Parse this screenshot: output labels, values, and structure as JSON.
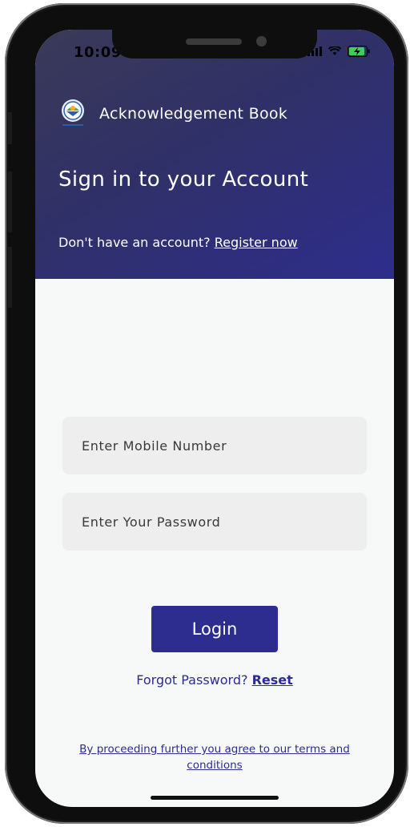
{
  "status_bar": {
    "time": "10:09",
    "icons": [
      "signal-icon",
      "wifi-icon",
      "battery-charging-icon"
    ]
  },
  "header": {
    "app_title": "Acknowledgement Book",
    "logo_icon": "app-logo-icon",
    "heading": "Sign in to your Account",
    "register_prompt": "Don't have an account?",
    "register_link": "Register now"
  },
  "form": {
    "mobile_placeholder": "Enter Mobile Number",
    "password_placeholder": "Enter Your Password",
    "login_label": "Login",
    "forgot_prompt": "Forgot Password?",
    "forgot_link": "Reset"
  },
  "footer": {
    "terms_text": "By proceeding further you agree to our terms and conditions"
  },
  "colors": {
    "primary": "#2d2d90",
    "header_gradient_start": "#3a3a58",
    "header_gradient_end": "#2e2d8c",
    "field_bg": "#eeeeee",
    "screen_bg": "#f7f8f8"
  }
}
